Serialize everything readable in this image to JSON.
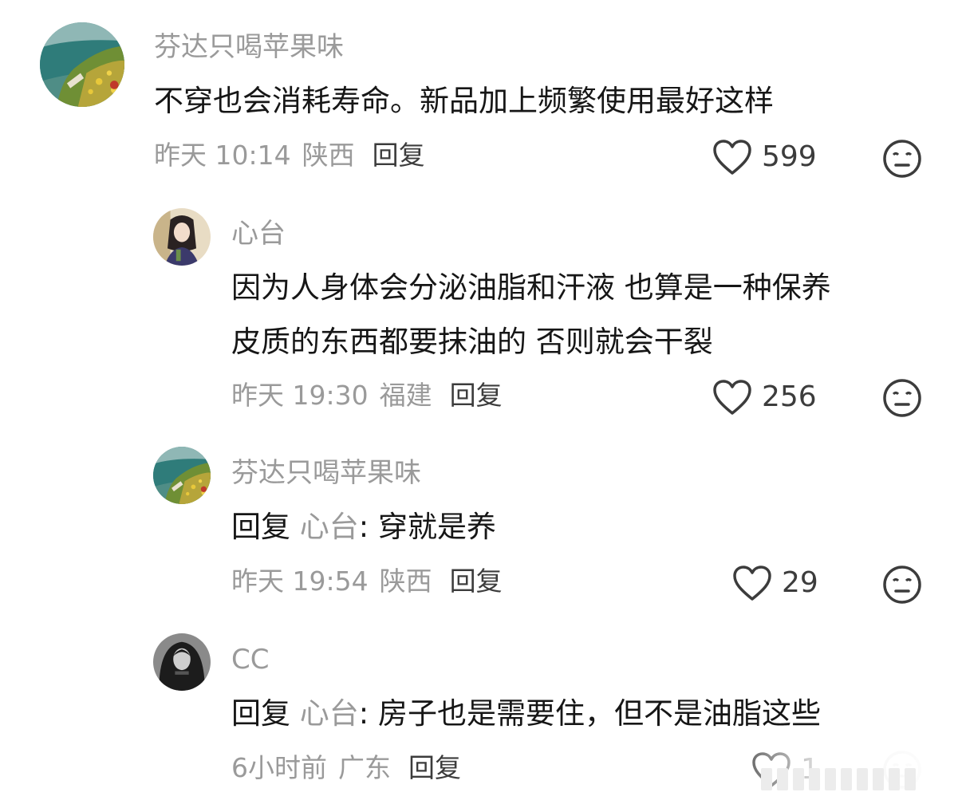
{
  "comments": [
    {
      "username": "芬达只喝苹果味",
      "text_lines": [
        "不穿也会消耗寿命。新品加上频繁使用最好这样"
      ],
      "time": "昨天 10:14",
      "location": "陕西",
      "reply_label": "回复",
      "likes": "599",
      "avatar_icon": "coastal-landscape-avatar"
    },
    {
      "username": "心台",
      "text_lines": [
        "因为人身体会分泌油脂和汗液 也算是一种保养",
        "皮质的东西都要抹油的 否则就会干裂"
      ],
      "time": "昨天 19:30",
      "location": "福建",
      "reply_label": "回复",
      "likes": "256",
      "avatar_icon": "girl-portrait-avatar"
    },
    {
      "username": "芬达只喝苹果味",
      "reply_prefix": "回复",
      "mention": "心台",
      "text": ": 穿就是养",
      "time": "昨天 19:54",
      "location": "陕西",
      "reply_label": "回复",
      "likes": "29",
      "avatar_icon": "coastal-landscape-avatar"
    },
    {
      "username": "CC",
      "reply_prefix": "回复",
      "mention": "心台",
      "text": ": 房子也是需要住，但不是油脂这些",
      "time": "6小时前",
      "location": "广东",
      "reply_label": "回复",
      "likes": "1",
      "avatar_icon": "dark-portrait-avatar"
    }
  ],
  "icons": {
    "like": "heart-outline-icon",
    "reaction": "neutral-face-icon"
  },
  "colors": {
    "text": "#161616",
    "muted": "#9a9a9a",
    "action": "#3c3c3c"
  }
}
